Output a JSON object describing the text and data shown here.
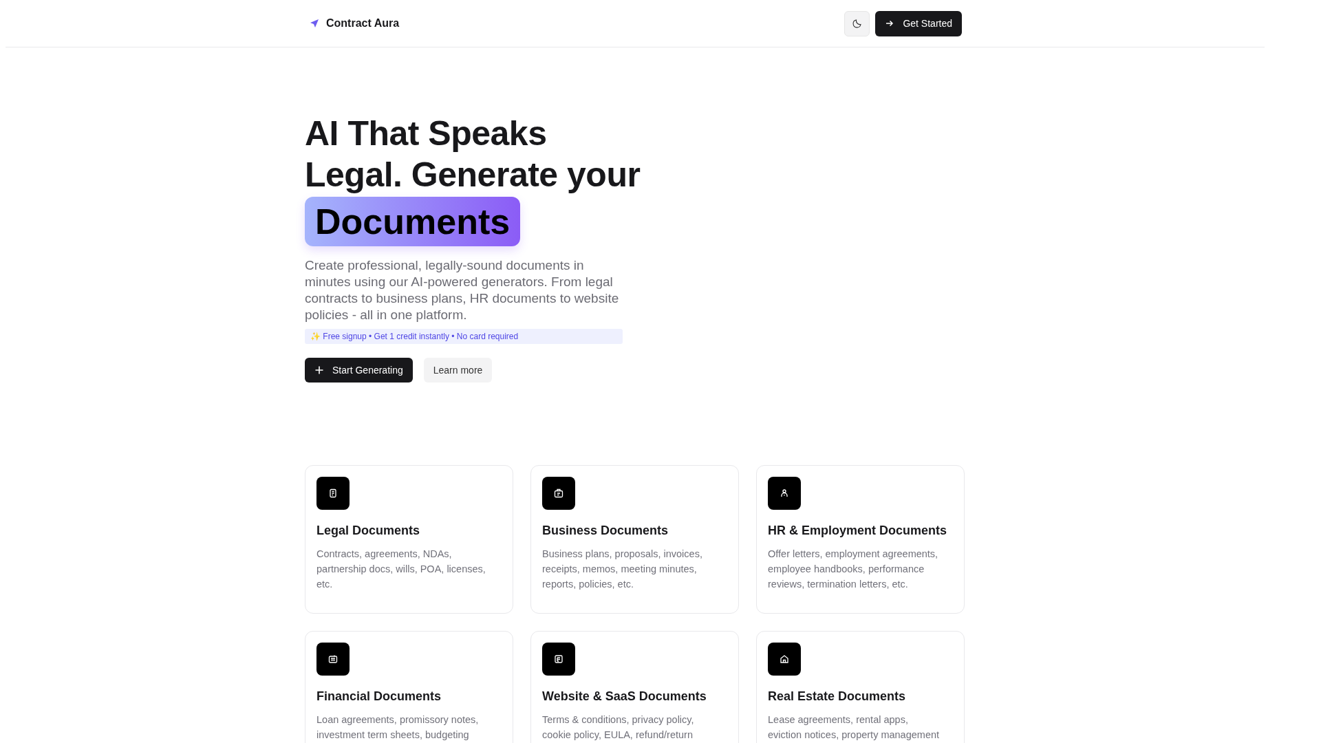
{
  "header": {
    "brand": "Contract Aura",
    "cta": "Get Started"
  },
  "hero": {
    "title": "AI That Speaks Legal. Generate your",
    "highlight": "Documents",
    "description": "Create professional, legally-sound documents in minutes using our AI-powered generators. From legal contracts to business plans, HR documents to website policies - all in one platform.",
    "badge_icon": "✨",
    "badge": "Free signup • Get 1 credit instantly • No card required",
    "primary_button": "Start Generating",
    "secondary_button": "Learn more"
  },
  "categories": [
    {
      "kind": "legal",
      "title": "Legal Documents",
      "description": "Contracts, agreements, NDAs, partnership docs, wills, POA, licenses, etc."
    },
    {
      "kind": "business",
      "title": "Business Documents",
      "description": "Business plans, proposals, invoices, receipts, memos, meeting minutes, reports, policies, etc."
    },
    {
      "kind": "hr",
      "title": "HR & Employment Documents",
      "description": "Offer letters, employment agreements, employee handbooks, performance reviews, termination letters, etc."
    },
    {
      "kind": "financial",
      "title": "Financial Documents",
      "description": "Loan agreements, promissory notes, investment term sheets, budgeting"
    },
    {
      "kind": "website",
      "title": "Website & SaaS Documents",
      "description": "Terms & conditions, privacy policy, cookie policy, EULA, refund/return"
    },
    {
      "kind": "realestate",
      "title": "Real Estate Documents",
      "description": "Lease agreements, rental apps, eviction notices, property management"
    }
  ]
}
